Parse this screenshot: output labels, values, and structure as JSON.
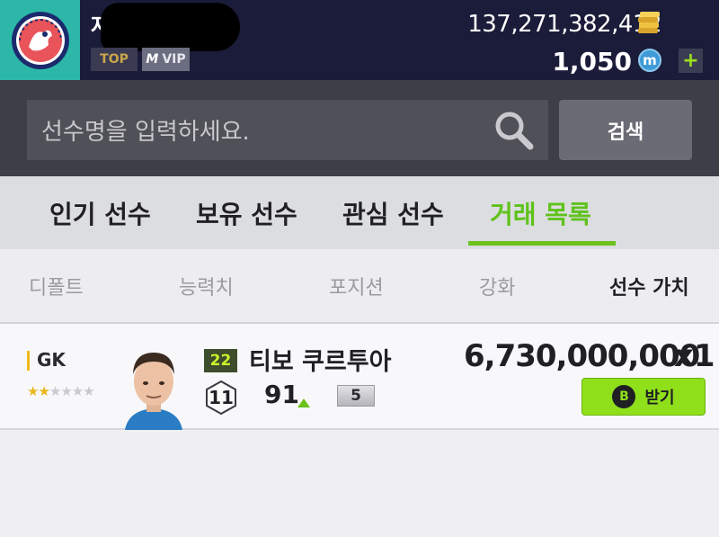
{
  "header": {
    "username": "자",
    "badges": {
      "top": "TOP",
      "vip_m": "M",
      "vip": "VIP"
    },
    "coins": "137,271,382,412",
    "points": "1,050",
    "points_icon_letter": "m",
    "plus": "+",
    "icons": {
      "avatar": "team-crest-icon",
      "coins": "coin-stack-icon",
      "points": "mileage-icon",
      "add": "plus-icon"
    }
  },
  "search": {
    "placeholder": "선수명을 입력하세요.",
    "button_label": "검색"
  },
  "tabs": [
    {
      "label": "인기 선수",
      "active": false
    },
    {
      "label": "보유 선수",
      "active": false
    },
    {
      "label": "관심 선수",
      "active": false
    },
    {
      "label": "거래 목록",
      "active": true
    }
  ],
  "sort": [
    {
      "label": "디폴트",
      "active": false
    },
    {
      "label": "능력치",
      "active": false
    },
    {
      "label": "포지션",
      "active": false
    },
    {
      "label": "강화",
      "active": false
    },
    {
      "label": "선수 가치",
      "active": true
    }
  ],
  "rows": [
    {
      "position": "GK",
      "stars_filled": 2,
      "stars_total": 6,
      "season": "22",
      "name": "티보 쿠르투아",
      "pay": "11",
      "ovr": "91",
      "upgrade": "5",
      "price": "6,730,000,000",
      "quantity": "x1",
      "action": {
        "icon_letter": "B",
        "label": "받기"
      }
    }
  ],
  "colors": {
    "header_bg": "#1b1c3a",
    "accent_green": "#6cc21b",
    "button_green": "#8fe01a",
    "search_bg": "#3d3e47",
    "tab_bg": "#dcdde0"
  }
}
